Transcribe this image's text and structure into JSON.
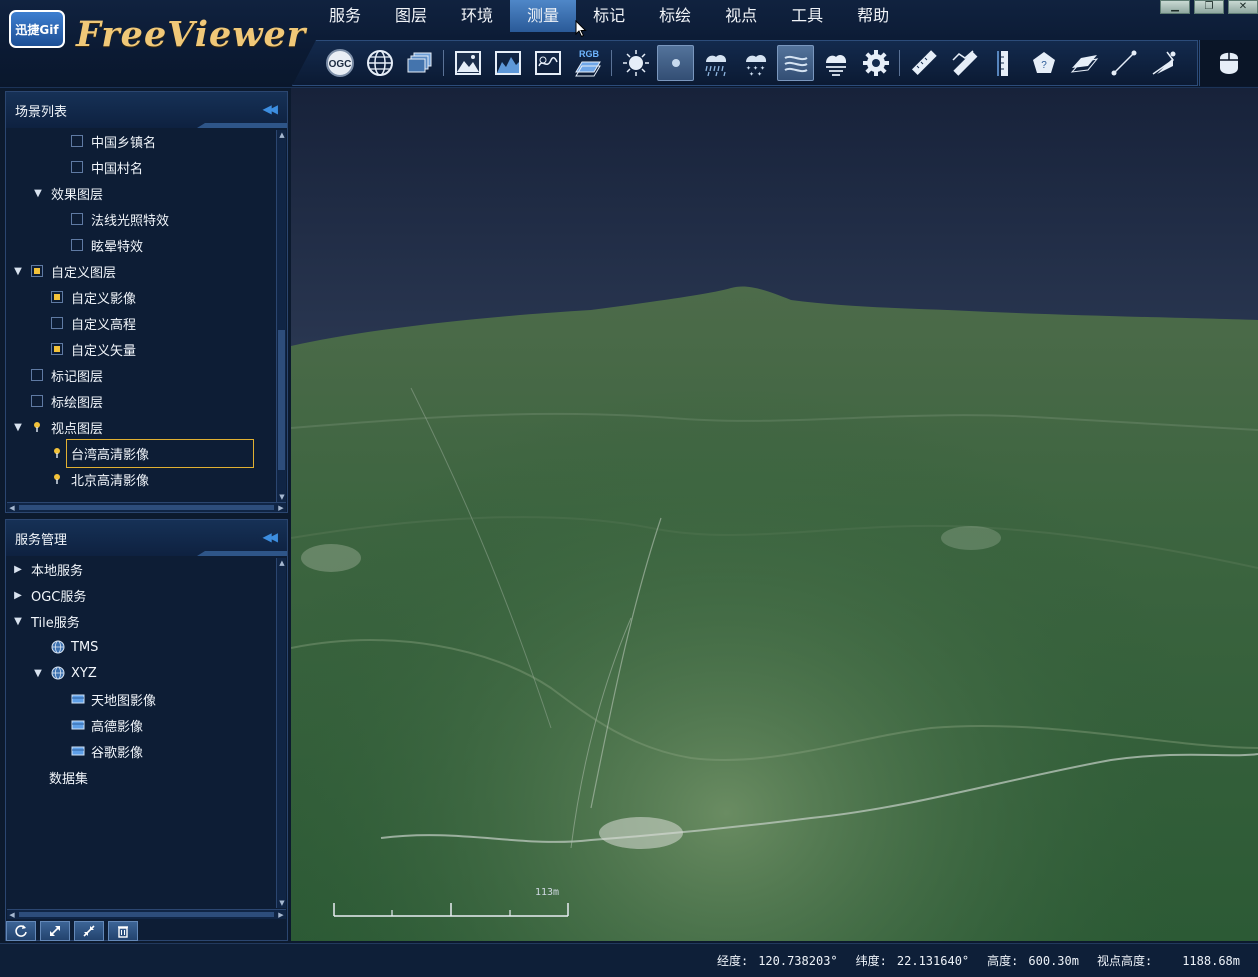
{
  "app": {
    "title": "FreeViewer",
    "badge": "迅捷Gif"
  },
  "menu": [
    {
      "label": "服务"
    },
    {
      "label": "图层"
    },
    {
      "label": "环境"
    },
    {
      "label": "测量",
      "active": true
    },
    {
      "label": "标记"
    },
    {
      "label": "标绘"
    },
    {
      "label": "视点"
    },
    {
      "label": "工具"
    },
    {
      "label": "帮助"
    }
  ],
  "toolbar": {
    "ogc_label": "OGC",
    "rgb_label": "RGB",
    "tools": [
      "ogc-icon",
      "globe-icon",
      "layers-icon",
      "image-terrain-icon",
      "elevation-icon",
      "map-view-icon",
      "rgb-layer-icon",
      "sun-icon",
      "atmosphere-icon",
      "rain-icon",
      "snow-icon",
      "fog-icon",
      "cloud-icon",
      "settings-icon",
      "distance-ruler-icon",
      "path-ruler-icon",
      "height-ruler-icon",
      "area-pentagon-icon",
      "surface-area-icon",
      "line-measure-icon",
      "angle-measure-icon"
    ]
  },
  "scene_panel": {
    "title": "场景列表",
    "items": [
      {
        "label": "中国乡镇名",
        "level": 2,
        "check": false
      },
      {
        "label": "中国村名",
        "level": 2,
        "check": false
      },
      {
        "label": "效果图层",
        "level": 1,
        "expand": true
      },
      {
        "label": "法线光照特效",
        "level": 2,
        "check": false
      },
      {
        "label": "眩晕特效",
        "level": 2,
        "check": false
      },
      {
        "label": "自定义图层",
        "level": 0,
        "expand": true,
        "check": true
      },
      {
        "label": "自定义影像",
        "level": 1,
        "check": true
      },
      {
        "label": "自定义高程",
        "level": 1,
        "check": false
      },
      {
        "label": "自定义矢量",
        "level": 1,
        "check": true
      },
      {
        "label": "标记图层",
        "level": 0,
        "check": false
      },
      {
        "label": "标绘图层",
        "level": 0,
        "check": false
      },
      {
        "label": "视点图层",
        "level": 0,
        "expand": true,
        "pin": true
      },
      {
        "label": "台湾高清影像",
        "level": 1,
        "pin": true,
        "selected": true
      },
      {
        "label": "北京高清影像",
        "level": 1,
        "pin": true
      }
    ]
  },
  "service_panel": {
    "title": "服务管理",
    "items": [
      {
        "label": "本地服务",
        "level": 0,
        "expand": false
      },
      {
        "label": "OGC服务",
        "level": 0,
        "expand": false
      },
      {
        "label": "Tile服务",
        "level": 0,
        "expand": true
      },
      {
        "label": "TMS",
        "level": 1,
        "icon": "globe-icon"
      },
      {
        "label": "XYZ",
        "level": 1,
        "icon": "globe-icon",
        "expand": true
      },
      {
        "label": "天地图影像",
        "level": 2,
        "icon": "tile-layer-icon"
      },
      {
        "label": "高德影像",
        "level": 2,
        "icon": "tile-layer-icon"
      },
      {
        "label": "谷歌影像",
        "level": 2,
        "icon": "tile-layer-icon"
      },
      {
        "label": "数据集",
        "level": 0,
        "leaf": true
      }
    ],
    "actions": [
      "refresh-icon",
      "expand-all-icon",
      "collapse-all-icon",
      "delete-icon"
    ]
  },
  "viewport": {
    "scale_label": "113m"
  },
  "status": {
    "lon_label": "经度:",
    "lon_value": "120.738203°",
    "lat_label": "纬度:",
    "lat_value": "22.131640°",
    "alt_label": "高度:",
    "alt_value": "600.30m",
    "eye_label": "视点高度:",
    "eye_value": "1188.68m"
  },
  "colors": {
    "accent": "#2a5a98",
    "checkbox_on": "#f2c23a",
    "title_gold": "#f0c878",
    "selected_outline": "#e0b032"
  }
}
